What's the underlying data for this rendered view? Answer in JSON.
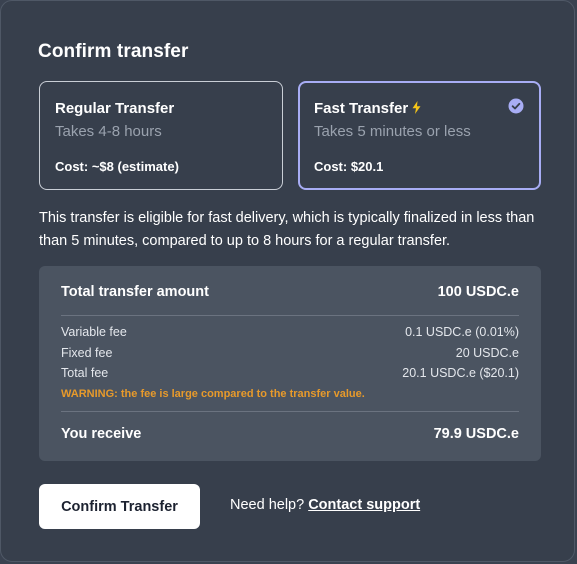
{
  "modal": {
    "title": "Confirm transfer"
  },
  "options": {
    "regular": {
      "name": "Regular Transfer",
      "time": "Takes 4-8 hours",
      "cost": "Cost: ~$8 (estimate)",
      "selected": false
    },
    "fast": {
      "name": "Fast Transfer",
      "time": "Takes 5 minutes or less",
      "cost": "Cost: $20.1",
      "selected": true,
      "icon": "lightning-bolt-icon"
    }
  },
  "description": "This transfer is eligible for fast delivery, which is typically finalized in less than than 5 minutes, compared to up to 8 hours for a regular transfer.",
  "summary": {
    "total_label": "Total transfer amount",
    "total_value": "100 USDC.e",
    "variable_fee_label": "Variable fee",
    "variable_fee_value": "0.1 USDC.e (0.01%)",
    "fixed_fee_label": "Fixed fee",
    "fixed_fee_value": "20 USDC.e",
    "total_fee_label": "Total fee",
    "total_fee_value": "20.1 USDC.e ($20.1)",
    "warning": "WARNING: the fee is large compared to the transfer value.",
    "receive_label": "You receive",
    "receive_value": "79.9 USDC.e"
  },
  "actions": {
    "confirm_label": "Confirm Transfer",
    "help_text": "Need help?",
    "support_link": "Contact support"
  },
  "colors": {
    "background": "#373f4c",
    "panel": "#4b5461",
    "selected_border": "#a8adf5",
    "warning": "#e79a2b",
    "bolt": "#f5c518"
  }
}
